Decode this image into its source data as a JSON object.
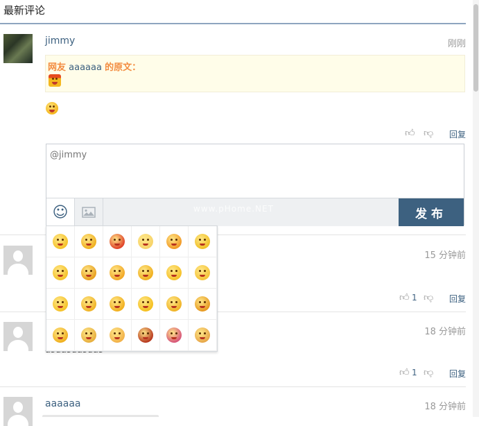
{
  "header": {
    "title": "最新评论"
  },
  "comments": [
    {
      "username": "jimmy",
      "time": "刚刚",
      "quote": {
        "prefix": "网友",
        "name": "aaaaaa",
        "suffix": "的原文："
      },
      "reply_label": "回复"
    },
    {
      "username": "",
      "time": "15 分钟前",
      "likes": "1",
      "reply_label": "回复"
    },
    {
      "username": "",
      "time": "18 分钟前",
      "text": "asdasdasdas",
      "likes": "1",
      "reply_label": "回复"
    },
    {
      "username": "aaaaaa",
      "time": "18 分钟前"
    }
  ],
  "reply_box": {
    "placeholder": "@jimmy",
    "submit_label": "发布",
    "watermark": "www.pHome.NET"
  },
  "emoji_panel": {
    "emojis": [
      "emoji-1",
      "emoji-2",
      "emoji-3",
      "emoji-4",
      "emoji-5",
      "emoji-6",
      "emoji-7",
      "emoji-8",
      "emoji-9",
      "emoji-10",
      "emoji-11",
      "emoji-12",
      "emoji-13",
      "emoji-14",
      "emoji-15",
      "emoji-16",
      "emoji-17",
      "emoji-18",
      "emoji-19",
      "emoji-20",
      "emoji-21",
      "emoji-22",
      "emoji-23",
      "emoji-24"
    ]
  },
  "colors": {
    "accent": "#3d6180",
    "quote_orange": "#f38c40",
    "quote_bg": "#fffde9"
  }
}
